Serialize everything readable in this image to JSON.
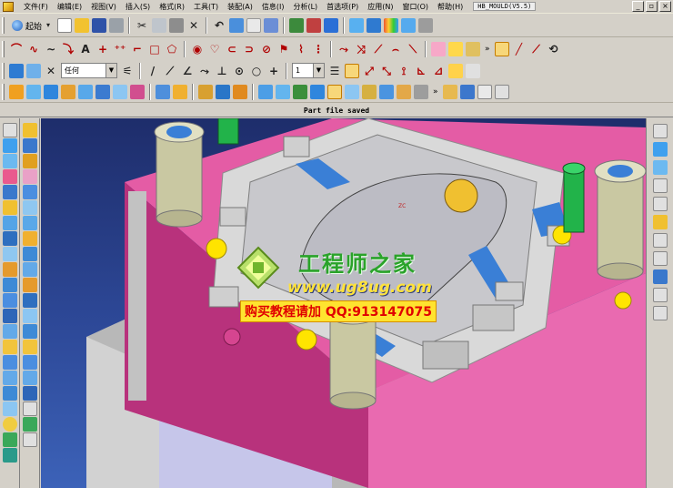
{
  "menu": {
    "items": [
      "文件(F)",
      "编辑(E)",
      "视图(V)",
      "插入(S)",
      "格式(R)",
      "工具(T)",
      "装配(A)",
      "信息(I)",
      "分析(L)",
      "首选项(P)",
      "应用(N)",
      "窗口(O)",
      "帮助(H)"
    ],
    "app_name": "HB_MOULD(V5.5)"
  },
  "window_controls": {
    "minimize": "_",
    "restore": "▫",
    "close": "×"
  },
  "toolbar": {
    "start_label": "起始",
    "filter_value": "任何",
    "layer_value": "1",
    "more_glyph": "»"
  },
  "status": {
    "text": "Part file saved"
  },
  "viewport": {
    "axis_label": "ZC"
  },
  "watermark": {
    "title": "工程师之家",
    "url": "www.ug8ug.com",
    "promo": "购买教程请加 QQ:913147075"
  },
  "colors": {
    "background": "#2d4897",
    "plate_pink": "#e45ca5",
    "pillar": "#c9c8a2",
    "cavity": "#d9d9d9",
    "accent_green": "#2aa32a",
    "accent_yellow": "#ffe23a"
  }
}
